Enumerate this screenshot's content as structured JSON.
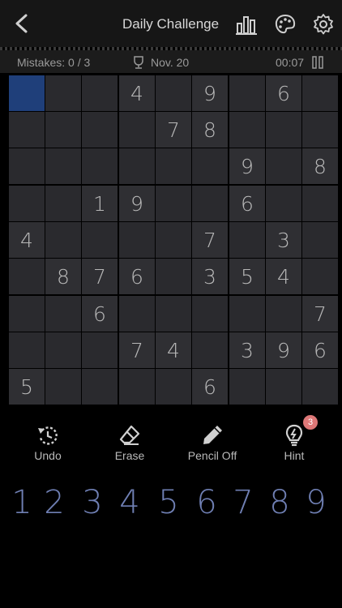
{
  "header": {
    "title": "Daily Challenge",
    "icons": [
      "back-icon",
      "stats-icon",
      "palette-icon",
      "settings-icon"
    ]
  },
  "status": {
    "mistakes": "Mistakes: 0 / 3",
    "date": "Nov. 20",
    "timer": "00:07"
  },
  "board": {
    "selected": [
      0,
      0
    ],
    "grid": [
      [
        "",
        "",
        "",
        "4",
        "",
        "9",
        "",
        "6",
        ""
      ],
      [
        "",
        "",
        "",
        "",
        "7",
        "8",
        "",
        "",
        ""
      ],
      [
        "",
        "",
        "",
        "",
        "",
        "",
        "9",
        "",
        "8"
      ],
      [
        "",
        "",
        "1",
        "9",
        "",
        "",
        "6",
        "",
        ""
      ],
      [
        "4",
        "",
        "",
        "",
        "",
        "7",
        "",
        "3",
        ""
      ],
      [
        "",
        "8",
        "7",
        "6",
        "",
        "3",
        "5",
        "4",
        ""
      ],
      [
        "",
        "",
        "6",
        "",
        "",
        "",
        "",
        "",
        "7"
      ],
      [
        "",
        "",
        "",
        "7",
        "4",
        "",
        "3",
        "9",
        "6"
      ],
      [
        "5",
        "",
        "",
        "",
        "",
        "6",
        "",
        "",
        ""
      ]
    ]
  },
  "tools": {
    "undo": "Undo",
    "erase": "Erase",
    "pencil": "Pencil Off",
    "hint": "Hint",
    "hint_count": "3"
  },
  "numpad": [
    "1",
    "2",
    "3",
    "4",
    "5",
    "6",
    "7",
    "8",
    "9"
  ],
  "colors": {
    "selected_cell": "#1f3f7a",
    "numpad": "#6f7fb3",
    "badge": "#dd7777"
  }
}
